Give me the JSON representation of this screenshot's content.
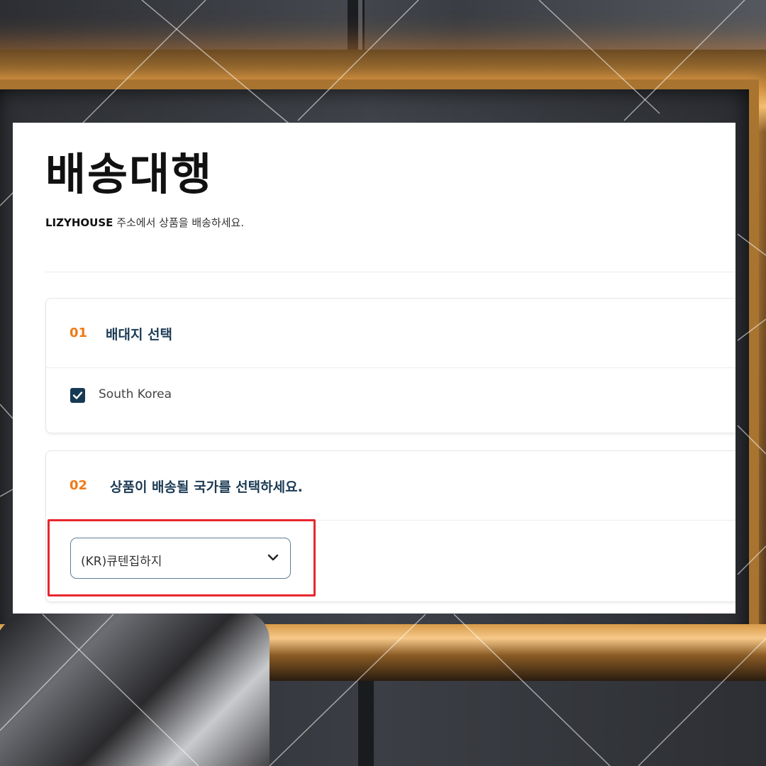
{
  "page": {
    "title": "배송대행",
    "subtitle_brand": "LIZYHOUSE",
    "subtitle_text": " 주소에서 상품을 배송하세요."
  },
  "step1": {
    "number": "01",
    "title": "배대지 선택",
    "checkbox_label": "South Korea",
    "checked": true
  },
  "step2": {
    "number": "02",
    "title": "상품이 배송될 국가를 선택하세요.",
    "select_value": "(KR)큐텐집하지"
  },
  "colors": {
    "step_number": "#f07a16",
    "step_title": "#1c3b55",
    "checkbox": "#173a54",
    "highlight": "#e8262e"
  },
  "icons": [
    "check-icon",
    "chevron-down-icon"
  ]
}
